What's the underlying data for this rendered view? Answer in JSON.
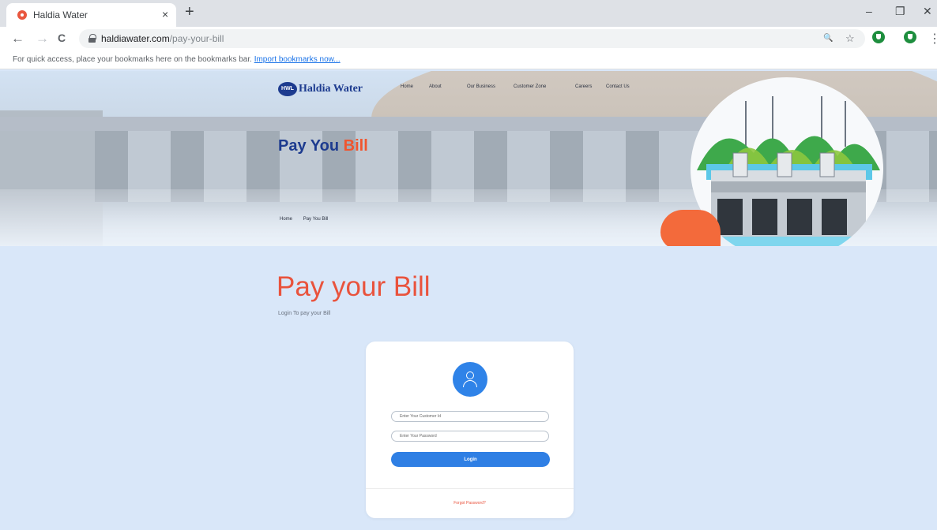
{
  "browser": {
    "tab_title": "Haldia Water",
    "url_domain": "haldiawater.com",
    "url_path": "/pay-your-bill",
    "bookmark_message": "For quick access, place your bookmarks here on the bookmarks bar.",
    "bookmark_import": "Import bookmarks now...",
    "new_tab": "+",
    "close_tab": "×",
    "back": "←",
    "forward": "→",
    "reload": "C",
    "zoom_icon": "🔍",
    "star_icon": "☆",
    "minimize": "–",
    "restore": "❐",
    "close_window": "✕",
    "menu": "⋮"
  },
  "site": {
    "logo_badge": "HWL",
    "logo_text": "Haldia Water",
    "nav": [
      "Home",
      "About",
      "Our Business",
      "Customer Zone",
      "Careers",
      "Contact Us"
    ],
    "hero_title_main": "Pay You ",
    "hero_title_accent": "Bill",
    "breadcrumb": [
      "Home",
      "Pay You Bill"
    ]
  },
  "page": {
    "title": "Pay your Bill",
    "subtitle": "Login To pay your Bill",
    "customer_id_placeholder": "Enter Your Customer Id",
    "password_placeholder": "Enter Your Password",
    "login_label": "Login",
    "forgot_label": "Forgot Password?"
  },
  "colors": {
    "accent": "#e9533d",
    "brand_blue": "#1d3b8f",
    "button_blue": "#2f7fe4",
    "page_background": "#d9e7f9"
  }
}
